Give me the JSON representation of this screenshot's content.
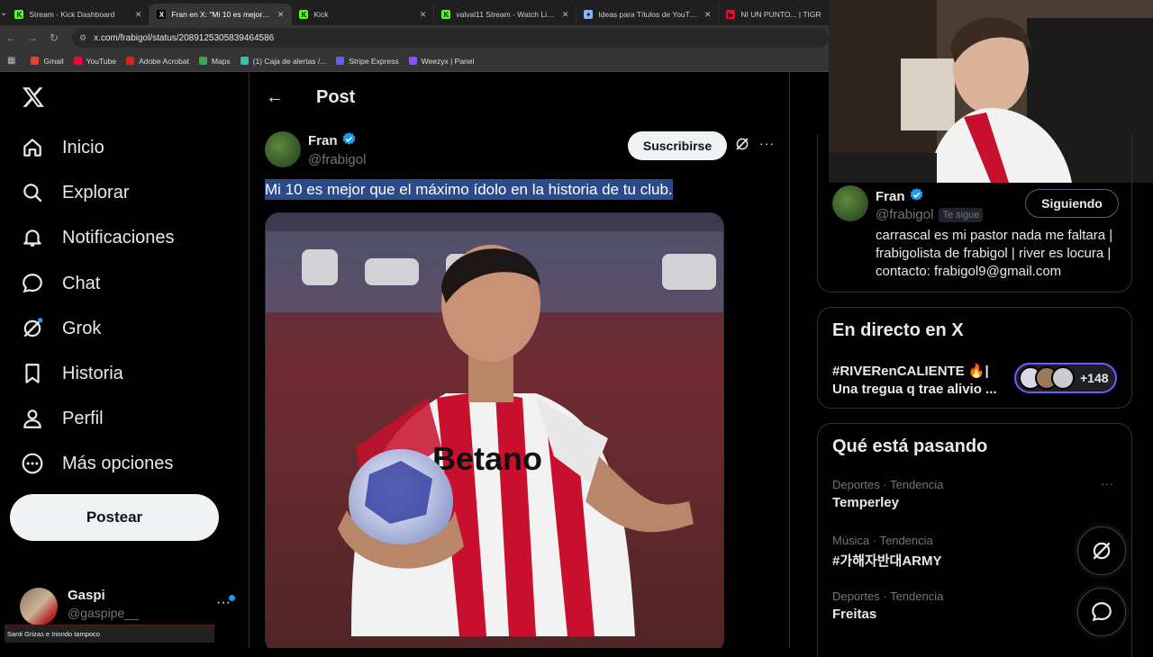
{
  "browser": {
    "tabs": [
      {
        "title": "Stream - Kick Dashboard",
        "icon": "kick-icon",
        "color": "#53fc18",
        "glyph": "K",
        "active": false
      },
      {
        "title": "Fran en X: \"Mi 10 es mejor que",
        "icon": "x-icon",
        "color": "#000000",
        "glyph": "X",
        "active": true
      },
      {
        "title": "Kick",
        "icon": "kick-icon",
        "color": "#53fc18",
        "glyph": "K",
        "active": false
      },
      {
        "title": "valval11 Stream - Watch Live o",
        "icon": "kick-icon",
        "color": "#53fc18",
        "glyph": "K",
        "active": false
      },
      {
        "title": "Ideas para Títulos de YouTube",
        "icon": "gemini-icon",
        "color": "#8ab4f8",
        "glyph": "✦",
        "active": false
      },
      {
        "title": "NI UN PUNTO... | TIGR",
        "icon": "youtube-icon",
        "color": "#ff0033",
        "glyph": "▶",
        "active": false
      }
    ],
    "url": "x.com/frabigol/status/2089125305839464586",
    "bookmarks": [
      {
        "label": "Gmail",
        "color": "#ea4335"
      },
      {
        "label": "YouTube",
        "color": "#ff0033"
      },
      {
        "label": "Adobe Acrobat",
        "color": "#d4271a"
      },
      {
        "label": "Maps",
        "color": "#34a853"
      },
      {
        "label": "(1) Caja de alertas /...",
        "color": "#32c3a2"
      },
      {
        "label": "Stripe Express",
        "color": "#635bff"
      },
      {
        "label": "Weezyx | Panel",
        "color": "#8a4fff"
      }
    ]
  },
  "nav": {
    "items": [
      {
        "label": "Inicio",
        "icon": "home-icon"
      },
      {
        "label": "Explorar",
        "icon": "search-icon"
      },
      {
        "label": "Notificaciones",
        "icon": "bell-icon"
      },
      {
        "label": "Chat",
        "icon": "chat-icon"
      },
      {
        "label": "Grok",
        "icon": "grok-icon"
      },
      {
        "label": "Historia",
        "icon": "bookmark-icon"
      },
      {
        "label": "Perfil",
        "icon": "person-icon"
      },
      {
        "label": "Más opciones",
        "icon": "more-circle-icon"
      }
    ],
    "post_button": "Postear",
    "account": {
      "name": "Gaspi",
      "handle": "@gaspipe__"
    }
  },
  "ticker": "Santi Grizas e Iriondo tampoco",
  "main": {
    "header": "Post",
    "author": {
      "name": "Fran",
      "handle": "@frabigol"
    },
    "subscribe": "Suscribirse",
    "text": "Mi 10 es mejor que el máximo ídolo en la historia de tu club."
  },
  "right": {
    "profile": {
      "name": "Fran",
      "handle": "@frabigol",
      "follows_you": "Te sigue",
      "follow_button": "Siguiendo",
      "bio": "carrascal es mi pastor nada me faltara | frabigolista de frabigol | river es locura | contacto: frabigol9@gmail.com"
    },
    "live": {
      "title": "En directo en X",
      "text": "#RIVERenCALIENTE 🔥| Una tregua q trae alivio ...",
      "count": "+148"
    },
    "trends": {
      "title": "Qué está pasando",
      "items": [
        {
          "category": "Deportes · Tendencia",
          "name": "Temperley"
        },
        {
          "category": "Música · Tendencia",
          "name": "#가해자반대ARMY"
        },
        {
          "category": "Deportes · Tendencia",
          "name": "Freitas"
        }
      ]
    }
  },
  "colors": {
    "accent": "#1d9bf0",
    "background": "#000000",
    "live": "#7856ff"
  }
}
